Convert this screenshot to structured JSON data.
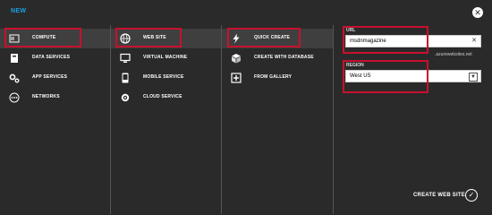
{
  "title": "NEW",
  "columns": {
    "categories": [
      {
        "label": "COMPUTE",
        "icon": "compute-icon"
      },
      {
        "label": "DATA SERVICES",
        "icon": "database-icon"
      },
      {
        "label": "APP SERVICES",
        "icon": "gears-icon"
      },
      {
        "label": "NETWORKS",
        "icon": "network-icon"
      }
    ],
    "compute": [
      {
        "label": "WEB SITE",
        "icon": "globe-icon"
      },
      {
        "label": "VIRTUAL MACHINE",
        "icon": "monitor-icon"
      },
      {
        "label": "MOBILE SERVICE",
        "icon": "mobile-icon"
      },
      {
        "label": "CLOUD SERVICE",
        "icon": "cloud-gear-icon"
      }
    ],
    "website": [
      {
        "label": "QUICK CREATE",
        "icon": "lightning-icon"
      },
      {
        "label": "CREATE WITH DATABASE",
        "icon": "cube-icon"
      },
      {
        "label": "FROM GALLERY",
        "icon": "plus-box-icon"
      }
    ]
  },
  "form": {
    "url_label": "URL",
    "url_value": "msdnmagazine",
    "url_suffix": ".azurewebsites.net",
    "region_label": "REGION",
    "region_value": "West US"
  },
  "create_label": "CREATE WEB SITE"
}
